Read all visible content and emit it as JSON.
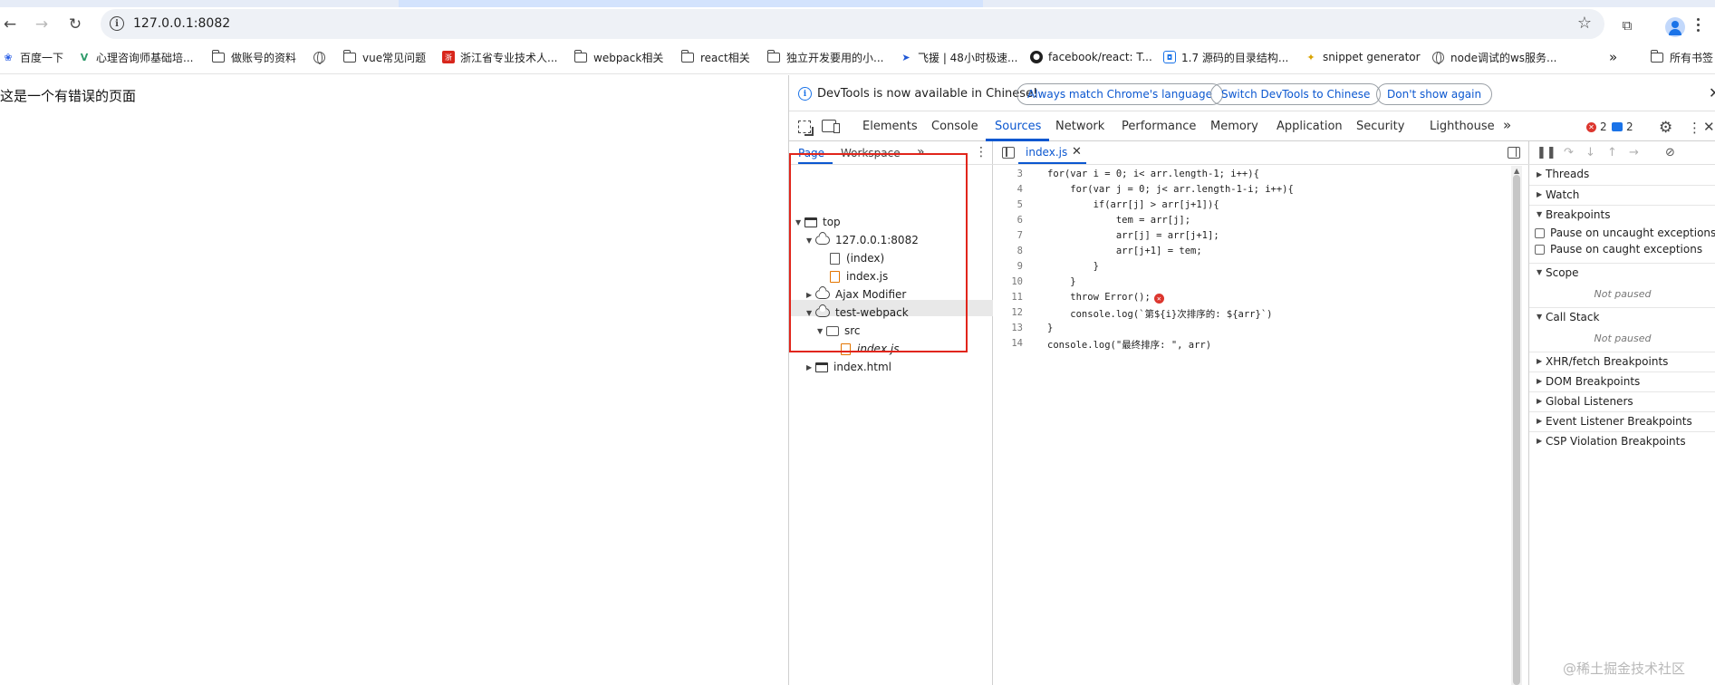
{
  "browser": {
    "url": "127.0.0.1:8082",
    "bookmarks": [
      {
        "label": "百度一下",
        "icon": "baidu-paw-icon"
      },
      {
        "label": "心理咨询师基础培...",
        "icon": "v-logo-icon"
      },
      {
        "label": "做账号的资料",
        "icon": "folder-icon"
      },
      {
        "label": "",
        "icon": "globe-icon"
      },
      {
        "label": "vue常见问题",
        "icon": "folder-icon"
      },
      {
        "label": "浙江省专业技术人...",
        "icon": "red-seal-icon"
      },
      {
        "label": "webpack相关",
        "icon": "folder-icon"
      },
      {
        "label": "react相关",
        "icon": "folder-icon"
      },
      {
        "label": "独立开发要用的小...",
        "icon": "folder-icon"
      },
      {
        "label": "飞援 | 48小时极速...",
        "icon": "feiyuan-icon"
      },
      {
        "label": "facebook/react: T...",
        "icon": "github-icon"
      },
      {
        "label": "1.7 源码的目录结构...",
        "icon": "robot-icon"
      },
      {
        "label": "snippet generator",
        "icon": "snippet-icon"
      },
      {
        "label": "node调试的ws服务...",
        "icon": "globe-icon"
      }
    ],
    "bookmarks_more": "»",
    "all_bookmarks": "所有书签"
  },
  "page": {
    "text": "这是一个有错误的页面"
  },
  "devtools": {
    "infobar": {
      "message": "DevTools is now available in Chinese!",
      "btn_match": "Always match Chrome's language",
      "btn_switch": "Switch DevTools to Chinese",
      "btn_dont_show": "Don't show again"
    },
    "tabs": [
      "Elements",
      "Console",
      "Sources",
      "Network",
      "Performance",
      "Memory",
      "Application",
      "Security",
      "Lighthouse"
    ],
    "active_tab": "Sources",
    "more_tabs": "»",
    "error_count": "2",
    "message_count": "2",
    "navigator_tabs": [
      "Page",
      "Workspace"
    ],
    "navigator_more": "»",
    "tree": [
      {
        "label": "top",
        "expanded": true
      },
      {
        "label": "127.0.0.1:8082",
        "expanded": true
      },
      {
        "label": "(index)"
      },
      {
        "label": "index.js"
      },
      {
        "label": "Ajax Modifier",
        "expanded": false
      },
      {
        "label": "test-webpack",
        "expanded": true
      },
      {
        "label": "src",
        "expanded": true
      },
      {
        "label": "index.js",
        "selected": true
      },
      {
        "label": "index.html",
        "expanded": false
      }
    ],
    "editor": {
      "open_file": "index.js",
      "lines": [
        {
          "n": "3",
          "code": "for(var i = 0; i< arr.length-1; i++){"
        },
        {
          "n": "4",
          "code": "    for(var j = 0; j< arr.length-1-i; i++){"
        },
        {
          "n": "5",
          "code": "        if(arr[j] > arr[j+1]){"
        },
        {
          "n": "6",
          "code": "            tem = arr[j];"
        },
        {
          "n": "7",
          "code": "            arr[j] = arr[j+1];"
        },
        {
          "n": "8",
          "code": "            arr[j+1] = tem;"
        },
        {
          "n": "9",
          "code": "        }"
        },
        {
          "n": "10",
          "code": "    }"
        },
        {
          "n": "11",
          "code": "    throw Error();"
        },
        {
          "n": "12",
          "code": "    console.log(`第${i}次排序的: ${arr}`)"
        },
        {
          "n": "13",
          "code": "}"
        },
        {
          "n": "14",
          "code": "console.log(\"最终排序: \", arr)"
        }
      ]
    },
    "debugger": {
      "sections": [
        "Threads",
        "Watch",
        "Breakpoints"
      ],
      "pause_uncaught": "Pause on uncaught exceptions",
      "pause_caught": "Pause on caught exceptions",
      "scope": "Scope",
      "not_paused": "Not paused",
      "call_stack": "Call Stack",
      "more_sections": [
        "XHR/fetch Breakpoints",
        "DOM Breakpoints",
        "Global Listeners",
        "Event Listener Breakpoints",
        "CSP Violation Breakpoints"
      ]
    }
  },
  "watermark": "@稀土掘金技术社区",
  "colors": {
    "accent": "#0b57d0",
    "error": "#dc362e",
    "highlight_box": "#e1251b"
  }
}
